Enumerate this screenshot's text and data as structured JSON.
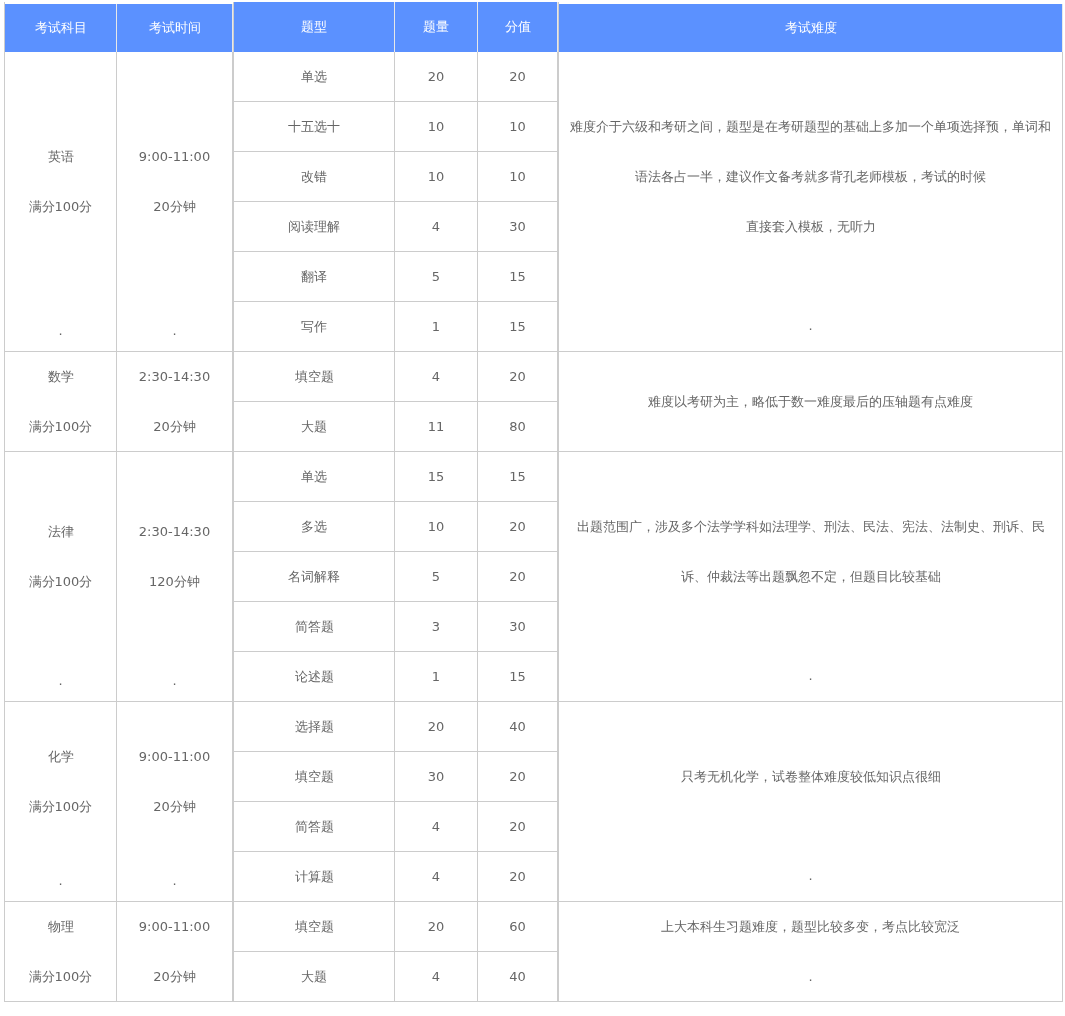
{
  "headers": {
    "left": [
      "考试科目",
      "考试时间"
    ],
    "middle": [
      "题型",
      "题量",
      "分值"
    ],
    "right": [
      "考试难度"
    ]
  },
  "subjects": [
    {
      "subject_lines": [
        "英语",
        "满分100分"
      ],
      "subject_end": ".",
      "time_lines": [
        "9:00-11:00",
        "20分钟"
      ],
      "time_end": ".",
      "difficulty": [
        "难度介于六级和考研之间，题型是在考研题型的基础上多加一个单项选择预，单词和语法各占一半，建议作文备考就多背孔老师模板，考试的时候",
        "直接套入模板，无听力"
      ],
      "difficulty_end": ".",
      "types": [
        {
          "type": "单选",
          "count": "20",
          "score": "20"
        },
        {
          "type": "十五选十",
          "count": "10",
          "score": "10"
        },
        {
          "type": "改错",
          "count": "10",
          "score": "10"
        },
        {
          "type": "阅读理解",
          "count": "4",
          "score": "30"
        },
        {
          "type": "翻译",
          "count": "5",
          "score": "15"
        },
        {
          "type": "写作",
          "count": "1",
          "score": "15"
        }
      ]
    },
    {
      "subject_lines": [
        "数学",
        "满分100分"
      ],
      "time_lines": [
        "2:30-14:30",
        "20分钟"
      ],
      "difficulty": [
        "难度以考研为主，略低于数一难度最后的压轴题有点难度"
      ],
      "types": [
        {
          "type": "填空题",
          "count": "4",
          "score": "20"
        },
        {
          "type": "大题",
          "count": "11",
          "score": "80"
        }
      ]
    },
    {
      "subject_lines": [
        "法律",
        "满分100分"
      ],
      "subject_end": ".",
      "time_lines": [
        "2:30-14:30",
        "120分钟"
      ],
      "time_end": ".",
      "difficulty": [
        "出题范围广，涉及多个法学学科如法理学、刑法、民法、宪法、法制史、刑诉、民诉、仲裁法等出题飘忽不定，但题目比较基础"
      ],
      "difficulty_end": ".",
      "types": [
        {
          "type": "单选",
          "count": "15",
          "score": "15"
        },
        {
          "type": "多选",
          "count": "10",
          "score": "20"
        },
        {
          "type": "名词解释",
          "count": "5",
          "score": "20"
        },
        {
          "type": "简答题",
          "count": "3",
          "score": "30"
        },
        {
          "type": "论述题",
          "count": "1",
          "score": "15"
        }
      ]
    },
    {
      "subject_lines": [
        "化学",
        "满分100分"
      ],
      "subject_end": ".",
      "time_lines": [
        "9:00-11:00",
        "20分钟"
      ],
      "time_end": ".",
      "difficulty": [
        "只考无机化学，试卷整体难度较低知识点很细"
      ],
      "difficulty_end": ".",
      "types": [
        {
          "type": "选择题",
          "count": "20",
          "score": "40"
        },
        {
          "type": "填空题",
          "count": "30",
          "score": "20"
        },
        {
          "type": "简答题",
          "count": "4",
          "score": "20"
        },
        {
          "type": "计算题",
          "count": "4",
          "score": "20"
        }
      ]
    },
    {
      "subject_lines": [
        "物理",
        "满分100分"
      ],
      "time_lines": [
        "9:00-11:00",
        "20分钟"
      ],
      "difficulty": [
        "上大本科生习题难度，题型比较多变，考点比较宽泛"
      ],
      "difficulty_end": ".",
      "types": [
        {
          "type": "填空题",
          "count": "20",
          "score": "60"
        },
        {
          "type": "大题",
          "count": "4",
          "score": "40"
        }
      ]
    }
  ]
}
